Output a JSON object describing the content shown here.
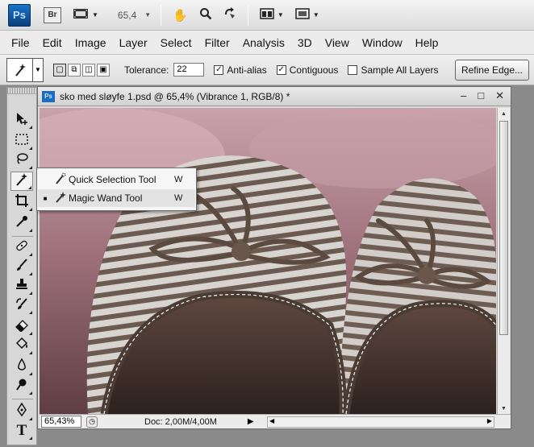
{
  "app": {
    "logo": "Ps",
    "bridge": "Br",
    "zoom_value": "65,4"
  },
  "menu": [
    "File",
    "Edit",
    "Image",
    "Layer",
    "Select",
    "Filter",
    "Analysis",
    "3D",
    "View",
    "Window",
    "Help"
  ],
  "options": {
    "tolerance_label": "Tolerance:",
    "tolerance_value": "22",
    "anti_alias_label": "Anti-alias",
    "anti_alias_checked": true,
    "contiguous_label": "Contiguous",
    "contiguous_checked": true,
    "sample_all_label": "Sample All Layers",
    "sample_all_checked": false,
    "refine_edge": "Refine Edge..."
  },
  "document": {
    "icon": "Ps",
    "title": "sko med sløyfe 1.psd @ 65,4% (Vibrance 1, RGB/8) *",
    "zoom_field": "65,43%",
    "doc_info": "Doc: 2,00M/4,00M"
  },
  "flyout": [
    {
      "label": "Quick Selection Tool",
      "key": "W",
      "selected": false
    },
    {
      "label": "Magic Wand Tool",
      "key": "W",
      "selected": true
    }
  ],
  "icons": {
    "hand": "hand-icon",
    "zoom": "zoom-icon",
    "rotate": "rotate-view-icon",
    "magic_wand": "magic-wand-icon"
  }
}
